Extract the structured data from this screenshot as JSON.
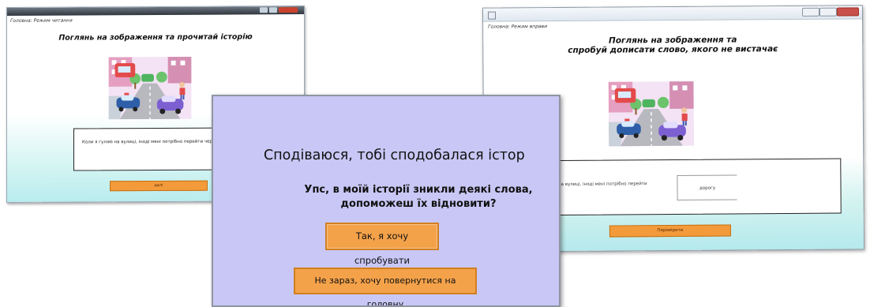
{
  "window_left": {
    "subtitle": "Головна: Режим читання",
    "heading": "Поглянь на зображення та прочитай історію",
    "story_text": "Коли я гуляю на вулиці, іноді мені потрібно перейти через дорогу",
    "button_label": "далі"
  },
  "window_dialog": {
    "hope_text": "Сподіваюся, тобі сподобалася істор",
    "question_text": "Упс, в моїй історії зникли деякі слова, допоможеш їх відновити?",
    "yes_button": "Так, я хочу спробувати",
    "no_button": "Не зараз, хочу повернутися на головну"
  },
  "window_right": {
    "subtitle": "Головна: Режим вправи",
    "heading_line1": "Поглянь на зображення та",
    "heading_line2": "спробуй дописати слово, якого не вистачає",
    "story_text": "Коли я гуляю на вулиці, іноді мені потрібно перейти через",
    "answer_value": "дорогу",
    "check_button": "Перевірити"
  },
  "colors": {
    "accent_orange": "#f39b3b",
    "dialog_background": "#c9c7f5",
    "window_gradient_bottom": "#b9ecee"
  }
}
